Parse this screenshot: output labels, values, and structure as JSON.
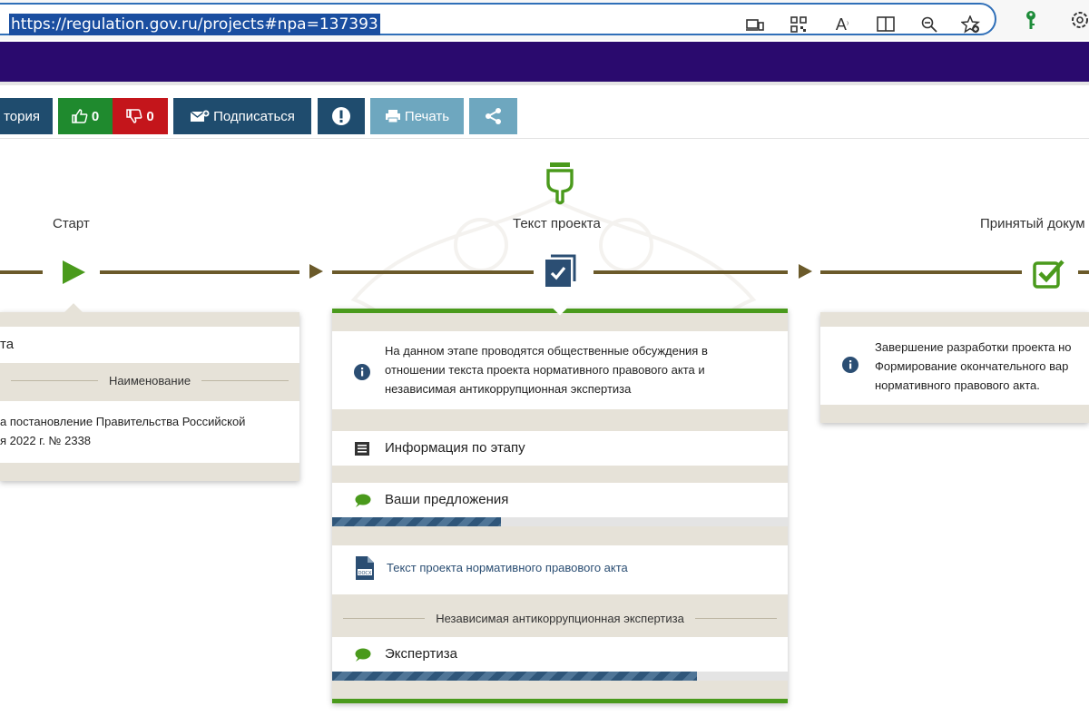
{
  "browser": {
    "url": "https://regulation.gov.ru/projects#npa=137393",
    "icons": [
      "home-icon",
      "device-icon",
      "qr-code-icon",
      "read-aloud-icon",
      "immersive-reader-icon",
      "zoom-out-icon",
      "add-favorite-icon",
      "key-icon",
      "extensions-icon"
    ]
  },
  "toolbar": {
    "history_label": "тория",
    "likes": "0",
    "dislikes": "0",
    "subscribe_label": "Подписаться",
    "print_label": "Печать",
    "colors": {
      "green": "#1f8a2e",
      "red": "#c4151b",
      "dark_blue": "#1f4c6e",
      "light_blue": "#6ea7bf"
    }
  },
  "timeline": {
    "stages": [
      {
        "label": "Старт",
        "icon": "play-icon"
      },
      {
        "label": "Текст проекта",
        "icon": "document-check-icon",
        "marker_icon": "hand-pointer-icon"
      },
      {
        "label": "Принятый докум",
        "icon": "checkbox-icon"
      }
    ]
  },
  "left_panel": {
    "title_fragment": "та",
    "separator": "Наименование",
    "text_line1": "а постановление Правительства Российской",
    "text_line2": "я 2022 г. № 2338"
  },
  "center_panel": {
    "info_line1": "На данном этапе проводятся общественные обсуждения в",
    "info_line2": "отношении текста проекта нормативного правового акта и",
    "info_line3": "независимая антикоррупционная экспертиза",
    "stage_info_label": "Информация по этапу",
    "proposals_label": "Ваши предложения",
    "proposals_progress": 0.37,
    "doc_label": "Текст проекта нормативного правового акта",
    "anticorruption_separator": "Независимая антикоррупционная экспертиза",
    "expertise_label": "Экспертиза",
    "expertise_progress": 0.8
  },
  "right_panel": {
    "info_line1": "Завершение разработки проекта но",
    "info_line2": "Формирование окончательного вар",
    "info_line3": "нормативного правового акта."
  },
  "colors": {
    "accent_green": "#4a9a1c",
    "timeline": "#6b5a2a",
    "header": "#2a0a6e",
    "link": "#2b4e73"
  }
}
